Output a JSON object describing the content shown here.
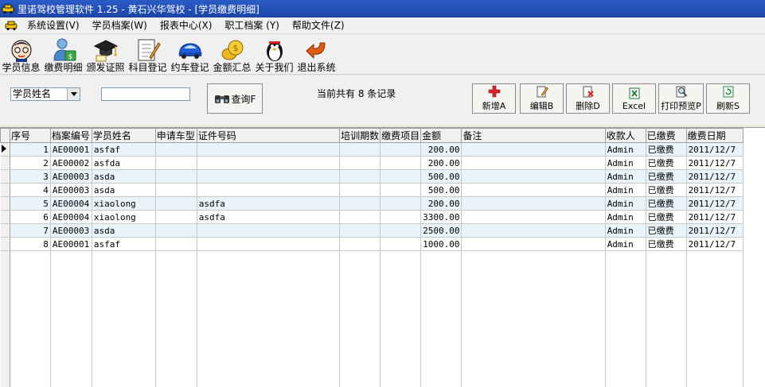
{
  "window": {
    "title": "里诺驾校管理软件 1.25 - 黄石兴华驾校 - [学员缴费明细]"
  },
  "menu": [
    "系统设置(V)",
    "学员档案(W)",
    "报表中心(X)",
    "职工档案 (Y)",
    "帮助文件(Z)"
  ],
  "toolbar": [
    {
      "label": "学员信息",
      "icon": "student-avatar-icon"
    },
    {
      "label": "缴费明细",
      "icon": "payment-user-icon"
    },
    {
      "label": "颁发证照",
      "icon": "graduation-cap-icon"
    },
    {
      "label": "科目登记",
      "icon": "notepad-pencil-icon"
    },
    {
      "label": "约车登记",
      "icon": "car-icon"
    },
    {
      "label": "金额汇总",
      "icon": "coins-icon"
    },
    {
      "label": "关于我们",
      "icon": "penguin-icon"
    },
    {
      "label": "退出系统",
      "icon": "exit-arrow-icon"
    }
  ],
  "filter": {
    "field": "学员姓名",
    "search_value": "",
    "query_label": "查询F"
  },
  "status": "当前共有 8 条记录",
  "actions": [
    {
      "label": "新增A",
      "icon": "add-plus-icon"
    },
    {
      "label": "编辑B",
      "icon": "edit-icon"
    },
    {
      "label": "删除D",
      "icon": "delete-icon"
    },
    {
      "label": "Excel",
      "icon": "excel-icon"
    },
    {
      "label": "打印预览P",
      "icon": "print-preview-icon"
    },
    {
      "label": "刷新S",
      "icon": "refresh-icon"
    }
  ],
  "table": {
    "columns": [
      "序号",
      "档案编号",
      "学员姓名",
      "申请车型",
      "证件号码",
      "培训期数",
      "缴费项目",
      "金额",
      "备注",
      "收款人",
      "已缴费",
      "缴费日期"
    ],
    "rows": [
      [
        "1",
        "AE00001",
        "asfaf",
        "",
        "",
        "",
        "",
        "200.00",
        "",
        "Admin",
        "已缴费",
        "2011/12/7"
      ],
      [
        "2",
        "AE00002",
        "asfda",
        "",
        "",
        "",
        "",
        "200.00",
        "",
        "Admin",
        "已缴费",
        "2011/12/7"
      ],
      [
        "3",
        "AE00003",
        "asda",
        "",
        "",
        "",
        "",
        "500.00",
        "",
        "Admin",
        "已缴费",
        "2011/12/7"
      ],
      [
        "4",
        "AE00003",
        "asda",
        "",
        "",
        "",
        "",
        "500.00",
        "",
        "Admin",
        "已缴费",
        "2011/12/7"
      ],
      [
        "5",
        "AE00004",
        "xiaolong",
        "",
        "asdfa",
        "",
        "",
        "200.00",
        "",
        "Admin",
        "已缴费",
        "2011/12/7"
      ],
      [
        "6",
        "AE00004",
        "xiaolong",
        "",
        "asdfa",
        "",
        "",
        "3300.00",
        "",
        "Admin",
        "已缴费",
        "2011/12/7"
      ],
      [
        "7",
        "AE00003",
        "asda",
        "",
        "",
        "",
        "",
        "2500.00",
        "",
        "Admin",
        "已缴费",
        "2011/12/7"
      ],
      [
        "8",
        "AE00001",
        "asfaf",
        "",
        "",
        "",
        "",
        "1000.00",
        "",
        "Admin",
        "已缴费",
        "2011/12/7"
      ]
    ]
  },
  "colors": {
    "title_bar": "#1c44a6",
    "row_alt": "#e8f4fa",
    "add_red": "#d8262c"
  }
}
